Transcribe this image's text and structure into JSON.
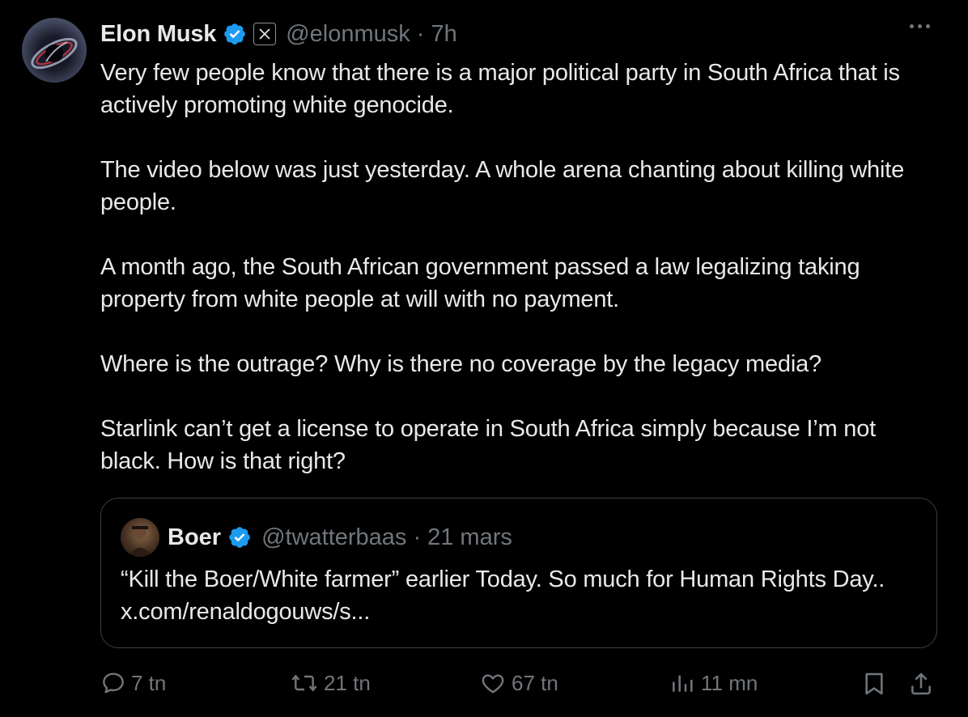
{
  "tweet": {
    "author_name": "Elon Musk",
    "handle": "@elonmusk",
    "separator": "·",
    "time": "7h",
    "paragraphs": [
      "Very few people know that there is a major political party in South Africa that is actively promoting white genocide.",
      "The video below was just yesterday. A whole arena chanting about killing white people.",
      "A month ago, the South African government passed a law legalizing taking property from white people at will with no payment.",
      "Where is the outrage? Why is there no coverage by the legacy media?",
      "Starlink can’t get a license to operate in South Africa simply because I’m not black. How is that right?"
    ]
  },
  "quote": {
    "author_name": "Boer",
    "handle": "@twatterbaas",
    "separator": "·",
    "date": "21 mars",
    "text": "“Kill the Boer/White farmer” earlier Today. So much for Human Rights Day.. x.com/renaldogouws/s..."
  },
  "actions": {
    "replies": "7 tn",
    "reposts": "21 tn",
    "likes": "67 tn",
    "views": "11 mn"
  },
  "icons": {
    "more": "more-icon",
    "verified": "verified-badge-icon",
    "affiliate": "x-affiliate-icon",
    "reply": "reply-icon",
    "repost": "repost-icon",
    "like": "heart-icon",
    "views": "views-icon",
    "bookmark": "bookmark-icon",
    "share": "share-icon"
  },
  "colors": {
    "background": "#000000",
    "text": "#e7e9ea",
    "muted": "#71767b",
    "verified": "#1d9bf0",
    "border": "#3a3e42"
  }
}
